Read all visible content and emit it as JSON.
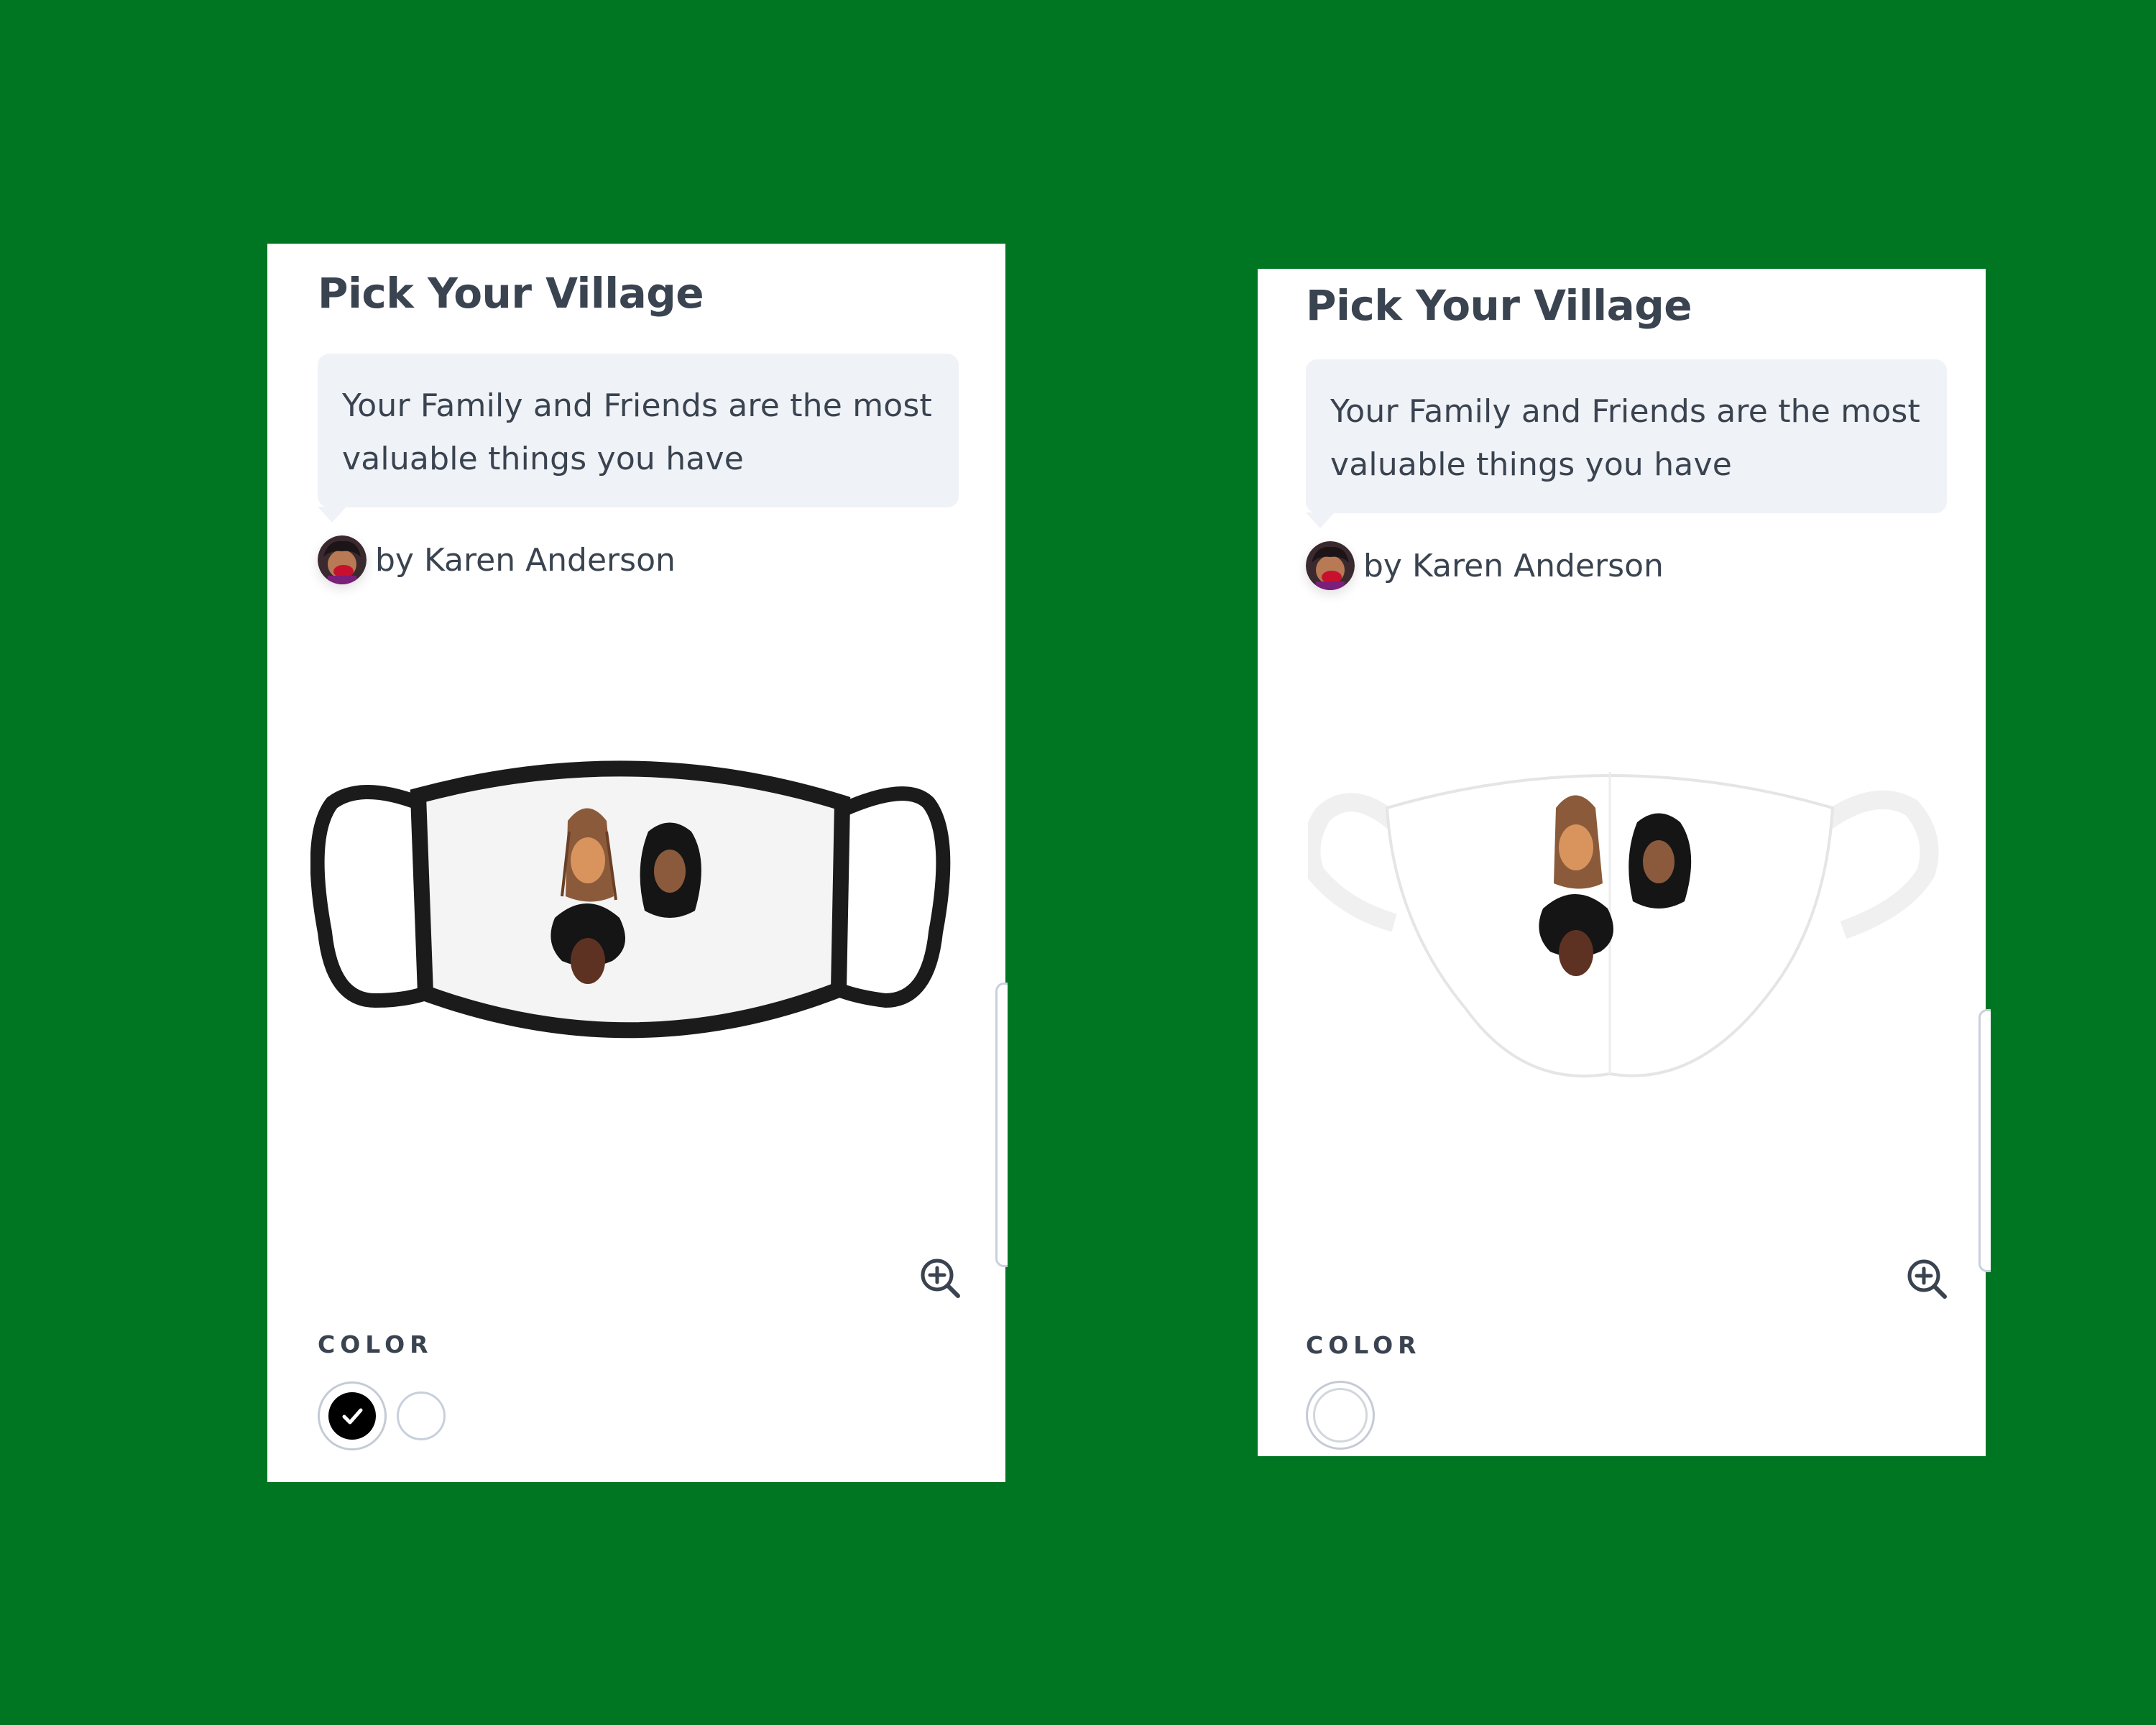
{
  "colors": {
    "background": "#007623",
    "card": "#ffffff",
    "text": "#3a4350",
    "bubble": "#eff2f6",
    "swatch_black": "#000000",
    "swatch_white": "#ffffff"
  },
  "cards": [
    {
      "title": "Pick Your Village",
      "description_line_1": "Your Family and Friends are the most",
      "description_line_2": "valuable things you have",
      "author": "by Karen Anderson",
      "product_variant": "black-trim face mask",
      "zoom_icon": "zoom-in-icon",
      "color_label": "COLOR",
      "swatches": [
        {
          "color": "#000000",
          "selected": true,
          "icon": "checkmark-icon"
        },
        {
          "color": "#ffffff",
          "selected": false
        }
      ]
    },
    {
      "title": "Pick Your Village",
      "description_line_1": "Your Family and Friends are the most",
      "description_line_2": "valuable things you have",
      "author": "by Karen Anderson",
      "product_variant": "white face mask",
      "zoom_icon": "zoom-in-icon",
      "color_label": "COLOR",
      "swatches": [
        {
          "color": "#ffffff",
          "selected": true
        }
      ]
    }
  ]
}
